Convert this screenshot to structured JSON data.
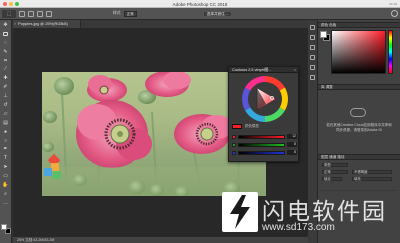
{
  "app": {
    "title": "Adobe Photoshop CC 2018"
  },
  "options_bar": {
    "mode_label": "样式",
    "mode_value": "正常",
    "select_mask_button": "选择并遮住..."
  },
  "document": {
    "tab_title": "Poppies.jpg @ 25%(RGB/8)",
    "status_text": "25%      文档:43.2M/43.2M"
  },
  "coolorus": {
    "title": "Coolorus 2.5 vinyet图...",
    "label": "颜色模型",
    "sliders": [
      {
        "name": "R",
        "value": "12",
        "color": "#ff1c26"
      },
      {
        "name": "G",
        "value": "8",
        "color": "#1f9d1f"
      },
      {
        "name": "B",
        "value": "8",
        "color": "#1f34d8"
      }
    ]
  },
  "panels": {
    "color_tabs": "颜色   色板",
    "libraries_tab": "库   调整",
    "libraries_text": "若在其他Creative Cloud应用程序中共享和同步资源，请登录到Adobe ID",
    "layers_tabs": "图层   通道   路径",
    "layer_kind": "类型",
    "blend_mode": "正常",
    "opacity": "不透明度",
    "lock": "锁定",
    "fill": "填充"
  },
  "watermark": {
    "text_cn": "闪电软件园",
    "url": "www.sd173.com"
  },
  "colors": {
    "accent_red": "#ff1c26",
    "poppy_pink": "#e2507c"
  }
}
